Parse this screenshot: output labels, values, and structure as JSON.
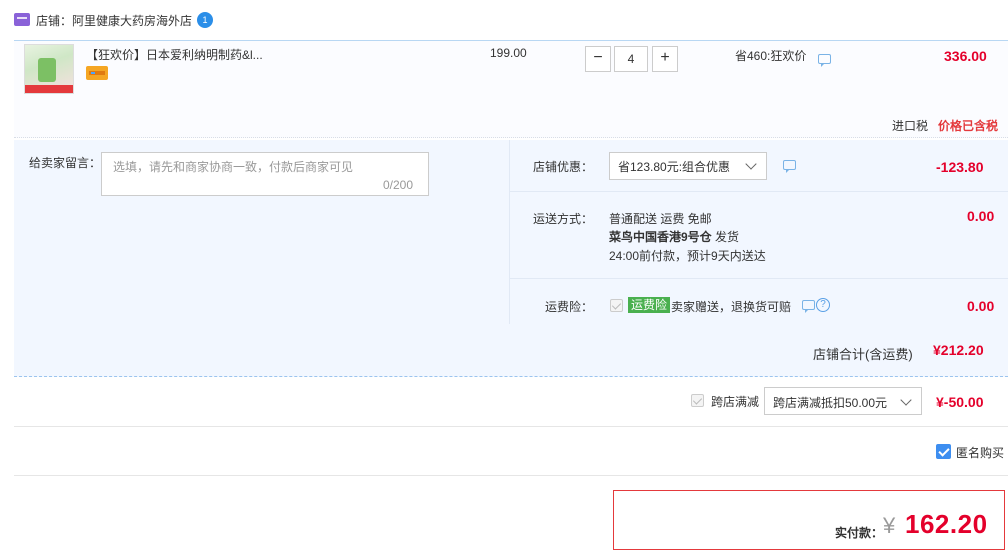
{
  "store": {
    "label": "店铺：阿里健康大药房海外店",
    "wangwang_badge": "1"
  },
  "item": {
    "title": "【狂欢价】日本爱利纳明制药&l...",
    "unit_price": "199.00",
    "quantity": "4",
    "qty_minus": "−",
    "qty_plus": "+",
    "discount_note": "省460:狂欢价",
    "subtotal": "336.00",
    "import_tax_label": "进口税",
    "import_tax_status": "价格已含税"
  },
  "message": {
    "label": "给卖家留言：",
    "placeholder": "选填，请先和商家协商一致，付款后商家可见",
    "counter": "0/200"
  },
  "shop_promo": {
    "label": "店铺优惠：",
    "selected": "省123.80元:组合优惠",
    "amount": "-123.80"
  },
  "shipping": {
    "label": "运送方式：",
    "line1": "普通配送 运费 免邮",
    "line2_bold": "菜鸟中国香港9号仓",
    "line2_rest": "  发货",
    "line3": "24:00前付款，预计9天内送达",
    "amount": "0.00"
  },
  "insurance": {
    "label": "运费险：",
    "badge": "运费险",
    "desc": "卖家赠送，退换货可赔",
    "help": "?",
    "amount": "0.00"
  },
  "store_total": {
    "label": "店铺合计(含运费)",
    "amount": "¥212.20"
  },
  "cross_store": {
    "label": "跨店满减",
    "selected": "跨店满减抵扣50.00元",
    "amount": "¥-50.00"
  },
  "anonymous": {
    "label": "匿名购买",
    "checked": true
  },
  "payment": {
    "label": "实付款：",
    "currency": "¥",
    "amount": "162.20"
  },
  "colors": {
    "accent_red": "#e4002b",
    "light_blue_bg": "#f2f7ff",
    "insurance_green": "#4ab04f",
    "checkbox_blue": "#3d8ef0"
  },
  "icons": [
    "store-icon",
    "wangwang-icon",
    "card-icon",
    "chat-icon",
    "chevron-down-icon",
    "help-icon",
    "check-icon"
  ]
}
